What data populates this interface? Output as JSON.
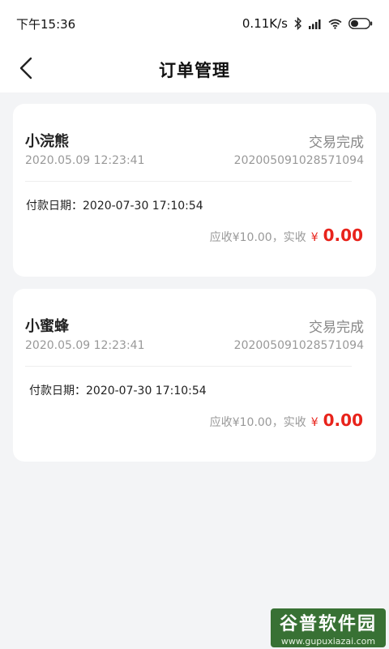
{
  "status_bar": {
    "time": "下午15:36",
    "speed": "0.11K/s",
    "icons": [
      "bluetooth-icon",
      "signal-icon",
      "wifi-icon",
      "battery-icon"
    ]
  },
  "nav": {
    "back_icon": "chevron-left-icon",
    "title": "订单管理"
  },
  "orders": [
    {
      "name": "小浣熊",
      "status": "交易完成",
      "datetime": "2020.05.09 12:23:41",
      "order_no": "202005091028571094",
      "pay_label": "付款日期：",
      "pay_date": "2020-07-30 17:10:54",
      "receivable_text": "应收¥10.00，实收",
      "currency_symbol": "¥",
      "actual_amount": "0.00"
    },
    {
      "name": "小蜜蜂",
      "status": "交易完成",
      "datetime": "2020.05.09 12:23:41",
      "order_no": "202005091028571094",
      "pay_label": "付款日期：",
      "pay_date": "2020-07-30 17:10:54",
      "receivable_text": "应收¥10.00，实收",
      "currency_symbol": "¥",
      "actual_amount": "0.00"
    }
  ],
  "watermark": {
    "title": "谷普软件园",
    "url": "www.gupuxiazai.com"
  },
  "colors": {
    "accent_red": "#e8231b",
    "background": "#f3f4f6",
    "card": "#ffffff",
    "muted_text": "#999999"
  }
}
